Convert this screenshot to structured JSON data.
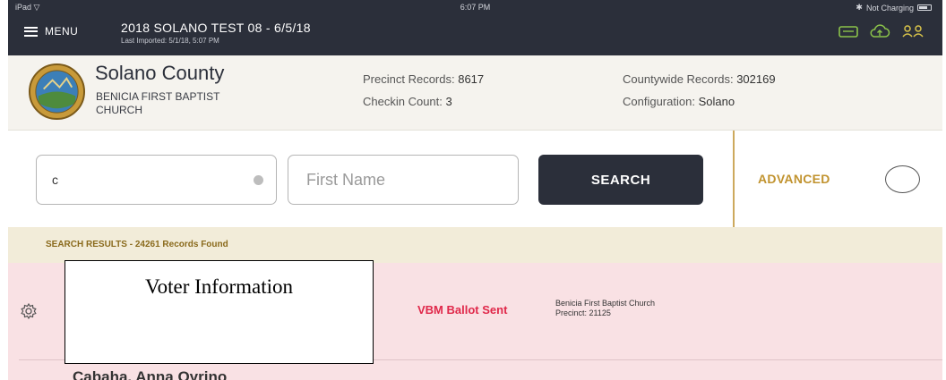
{
  "status_bar": {
    "device": "iPad",
    "time": "6:07 PM",
    "charging": "Not Charging"
  },
  "header": {
    "menu_label": "MENU",
    "election_title": "2018 SOLANO TEST 08 - 6/5/18",
    "last_imported": "Last Imported: 5/1/18, 5:07 PM"
  },
  "county": {
    "name": "Solano County",
    "site": "BENICIA FIRST BAPTIST CHURCH",
    "precinct_records_label": "Precinct Records:",
    "precinct_records_value": "8617",
    "checkin_count_label": "Checkin Count:",
    "checkin_count_value": "3",
    "countywide_records_label": "Countywide Records:",
    "countywide_records_value": "302169",
    "configuration_label": "Configuration:",
    "configuration_value": "Solano"
  },
  "search": {
    "last_name_value": "c",
    "first_name_placeholder": "First Name",
    "search_label": "SEARCH",
    "advanced_label": "ADVANCED"
  },
  "results": {
    "summary": "SEARCH RESULTS - 24261 Records Found"
  },
  "result_row": {
    "status": "VBM Ballot Sent",
    "site": "Benicia First Baptist Church",
    "precinct": "Precinct: 21125",
    "next_name": "Cabaha, Anna Oyrino"
  },
  "overlay": {
    "label": "Voter Information"
  },
  "colors": {
    "header_bg": "#2b2f3a",
    "accent_gold": "#c1932f",
    "status_red": "#e0284a",
    "row_bg": "#f9e1e4",
    "icon_green": "#8bc34a"
  }
}
